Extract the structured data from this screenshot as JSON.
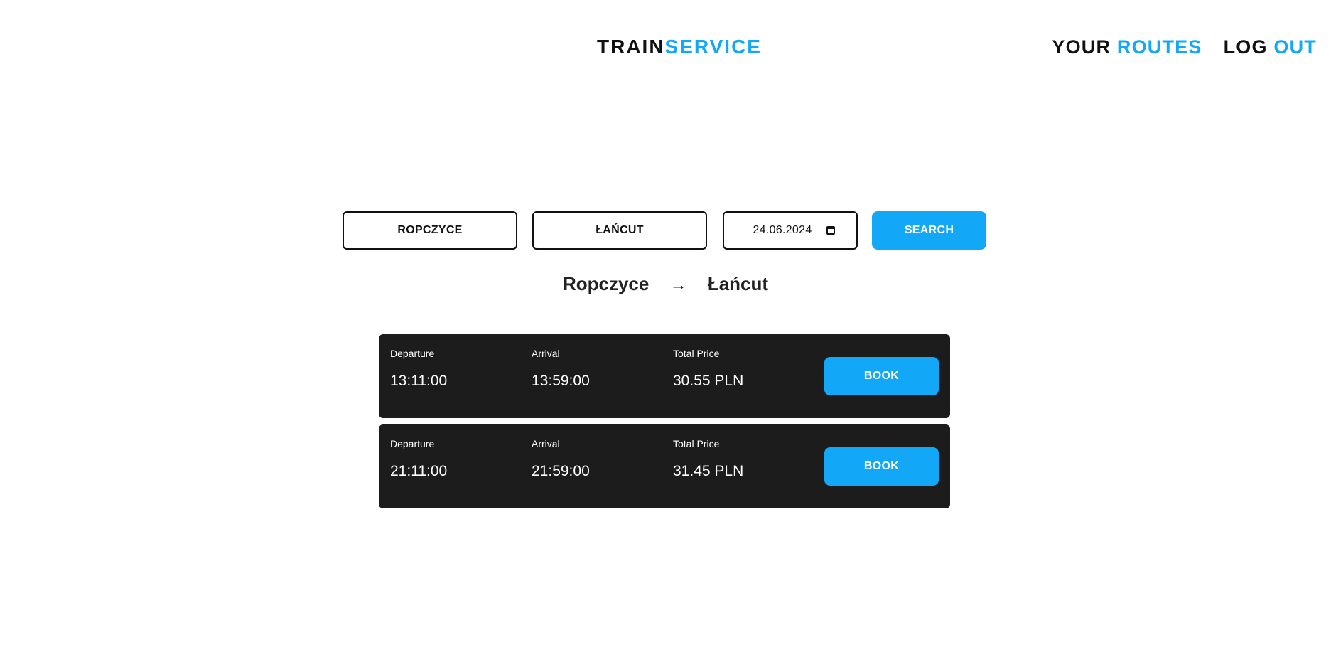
{
  "header": {
    "logo_part1": "TRAIN",
    "logo_part2": "SERVICE",
    "nav": {
      "your_routes_part1": "YOUR",
      "your_routes_part2": "ROUTES",
      "logout_part1": "LOG",
      "logout_part2": "OUT"
    }
  },
  "search": {
    "from_value": "ROPCZYCE",
    "to_value": "ŁAŃCUT",
    "date_value": "24.06.2024",
    "date_icon": "calendar-icon",
    "button_label": "SEARCH"
  },
  "route": {
    "from": "Ropczyce",
    "arrow": "→",
    "to": "Łańcut"
  },
  "results": [
    {
      "departure_label": "Departure",
      "departure": "13:11:00",
      "arrival_label": "Arrival",
      "arrival": "13:59:00",
      "price_label": "Total Price",
      "price": "30.55 PLN",
      "button_label": "BOOK"
    },
    {
      "departure_label": "Departure",
      "departure": "21:11:00",
      "arrival_label": "Arrival",
      "arrival": "21:59:00",
      "price_label": "Total Price",
      "price": "31.45 PLN",
      "button_label": "BOOK"
    }
  ],
  "colors": {
    "accent": "#12a8f7",
    "card_background": "#1c1c1c",
    "text_dark": "#111111"
  }
}
